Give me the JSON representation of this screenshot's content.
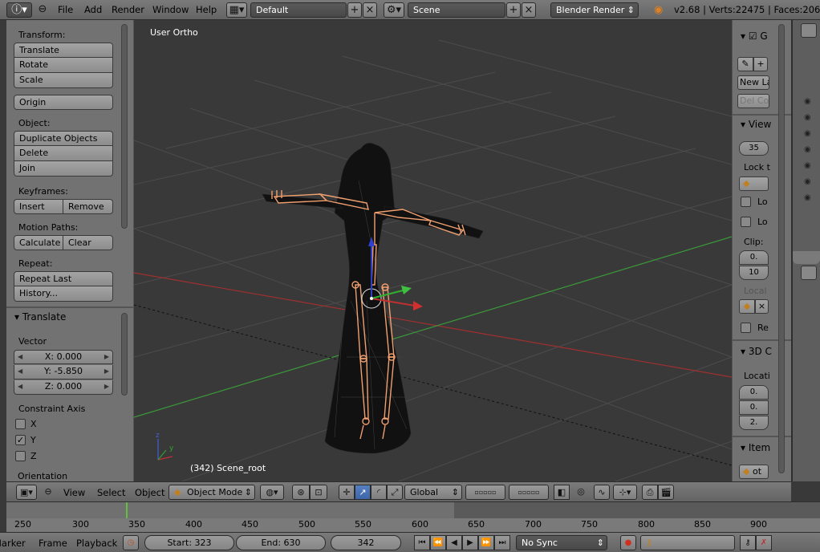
{
  "topbar": {
    "menus": [
      "File",
      "Add",
      "Render",
      "Window",
      "Help"
    ],
    "screen_layout": "Default",
    "scene": "Scene",
    "render_engine": "Blender Render",
    "info": "v2.68 | Verts:22475 | Faces:20699"
  },
  "toolshelf": {
    "transform_label": "Transform:",
    "translate": "Translate",
    "rotate": "Rotate",
    "scale": "Scale",
    "origin": "Origin",
    "object_label": "Object:",
    "duplicate": "Duplicate Objects",
    "delete": "Delete",
    "join": "Join",
    "keyframes_label": "Keyframes:",
    "insert": "Insert",
    "remove": "Remove",
    "motion_paths_label": "Motion Paths:",
    "calculate": "Calculate",
    "clear": "Clear",
    "repeat_label": "Repeat:",
    "repeat_last": "Repeat Last",
    "history": "History..."
  },
  "operator_panel": {
    "title": "Translate",
    "vector_label": "Vector",
    "x": "X: 0.000",
    "y": "Y: -5.850",
    "z": "Z: 0.000",
    "constraint_label": "Constraint Axis",
    "axes": [
      {
        "label": "X",
        "checked": false
      },
      {
        "label": "Y",
        "checked": true
      },
      {
        "label": "Z",
        "checked": false
      }
    ],
    "orientation_label": "Orientation"
  },
  "viewport": {
    "view_name": "User Ortho",
    "object_info": "(342) Scene_root"
  },
  "npanel": {
    "g_label": "G",
    "new_layer": "New La",
    "del_con": "Del Con",
    "view_header": "View",
    "lens": "35",
    "lock_label": "Lock t",
    "lo1": "Lo",
    "lo2": "Lo",
    "clip_label": "Clip:",
    "clip_start": "0.",
    "clip_end": "10",
    "local_label": "Local",
    "re_label": "Re",
    "cursor_header": "3D C",
    "location_label": "Locati",
    "loc_x": "0.",
    "loc_y": "0.",
    "loc_z": "2.",
    "item_header": "Item",
    "item_name": "ot"
  },
  "view_header": {
    "menus": [
      "View",
      "Select",
      "Object"
    ],
    "mode": "Object Mode",
    "orientation": "Global"
  },
  "timeline": {
    "ticks": [
      "250",
      "300",
      "350",
      "400",
      "450",
      "500",
      "550",
      "600",
      "650",
      "700",
      "750",
      "800",
      "850",
      "900"
    ]
  },
  "timeline_header": {
    "menus": [
      "Marker",
      "Frame",
      "Playback"
    ],
    "start": "Start: 323",
    "end": "End: 630",
    "current": "342",
    "sync": "No Sync"
  },
  "colors": {
    "accent": "#5680c2",
    "bone": "#f0a070",
    "x_axis": "#c03030",
    "y_axis": "#40c040",
    "playhead": "#60c040"
  }
}
